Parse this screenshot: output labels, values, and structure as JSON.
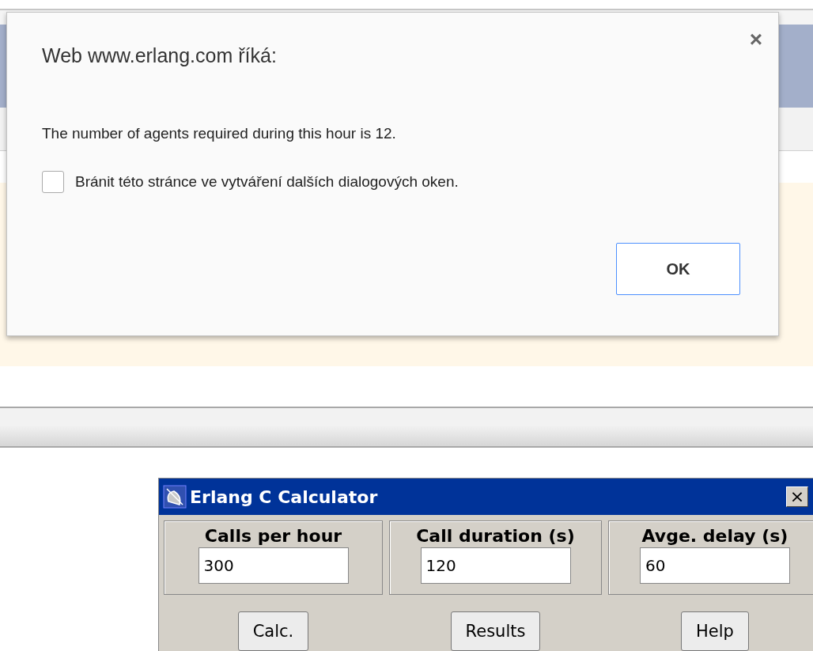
{
  "dialog": {
    "title": "Web www.erlang.com říká:",
    "close": "×",
    "message": "The number of agents required during this hour is 12.",
    "checkbox": {
      "label": "Bránit této stránce ve vytváření dalších dialogových oken.",
      "checked": false
    },
    "buttons": [
      {
        "label": "OK"
      }
    ]
  },
  "calculator": {
    "title": "Erlang C Calculator",
    "close": "×",
    "fields": [
      {
        "label": "Calls per hour",
        "value": "300"
      },
      {
        "label": "Call duration (s)",
        "value": "120"
      },
      {
        "label": "Avge. delay (s)",
        "value": "60"
      }
    ],
    "buttons": [
      {
        "label": "Calc."
      },
      {
        "label": "Results"
      },
      {
        "label": "Help"
      }
    ]
  }
}
